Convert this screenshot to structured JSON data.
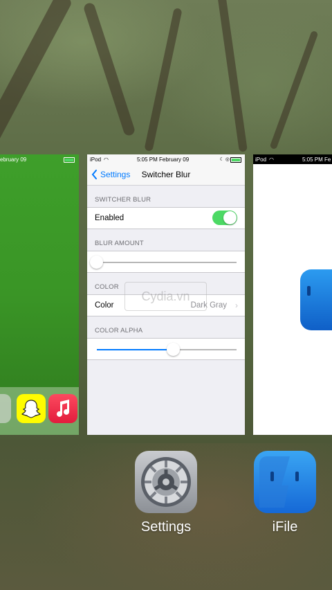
{
  "cards": {
    "left": {
      "status_text": "ebruary 09"
    },
    "middle": {
      "status": {
        "carrier": "iPod",
        "time": "5:05 PM February 09"
      },
      "nav": {
        "back_label": "Settings",
        "title": "Switcher Blur"
      },
      "sections": {
        "switcher_blur": {
          "header": "SWITCHER BLUR",
          "enabled_label": "Enabled",
          "enabled": true
        },
        "blur_amount": {
          "header": "BLUR AMOUNT",
          "value": 0.0
        },
        "color": {
          "header": "COLOR",
          "label": "Color",
          "value": "Dark Gray"
        },
        "color_alpha": {
          "header": "COLOR ALPHA",
          "value": 0.55
        }
      },
      "watermark": "Cydia.vn"
    },
    "right": {
      "status": {
        "carrier": "iPod",
        "time": "5:05 PM Fe"
      }
    }
  },
  "apps": [
    {
      "name": "Settings",
      "icon": "gear-icon"
    },
    {
      "name": "iFile",
      "icon": "finder-face-icon"
    }
  ],
  "colors": {
    "accent": "#007aff",
    "toggle_on": "#4cd964",
    "ifile_blue": "#1e88e5"
  }
}
